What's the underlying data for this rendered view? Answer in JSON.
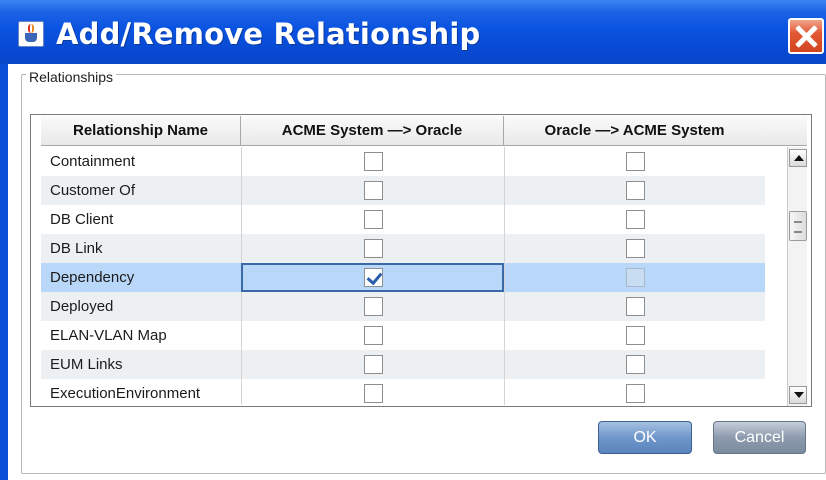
{
  "window": {
    "title": "Add/Remove Relationship",
    "icon": "java-cup-icon",
    "close_icon": "close-icon"
  },
  "group": {
    "label": "Relationships"
  },
  "table": {
    "headers": [
      "Relationship Name",
      "ACME System —> Oracle",
      "Oracle —> ACME System"
    ],
    "rows": [
      {
        "name": "Containment",
        "acme_to_oracle": false,
        "oracle_to_acme": false,
        "selected": false
      },
      {
        "name": "Customer Of",
        "acme_to_oracle": false,
        "oracle_to_acme": false,
        "selected": false
      },
      {
        "name": "DB Client",
        "acme_to_oracle": false,
        "oracle_to_acme": false,
        "selected": false
      },
      {
        "name": "DB Link",
        "acme_to_oracle": false,
        "oracle_to_acme": false,
        "selected": false
      },
      {
        "name": "Dependency",
        "acme_to_oracle": true,
        "oracle_to_acme": false,
        "selected": true,
        "oracle_to_acme_disabled": true
      },
      {
        "name": "Deployed",
        "acme_to_oracle": false,
        "oracle_to_acme": false,
        "selected": false
      },
      {
        "name": "ELAN-VLAN Map",
        "acme_to_oracle": false,
        "oracle_to_acme": false,
        "selected": false
      },
      {
        "name": "EUM Links",
        "acme_to_oracle": false,
        "oracle_to_acme": false,
        "selected": false
      },
      {
        "name": "ExecutionEnvironment",
        "acme_to_oracle": false,
        "oracle_to_acme": false,
        "selected": false
      }
    ]
  },
  "buttons": {
    "ok": "OK",
    "cancel": "Cancel"
  },
  "colors": {
    "titlebar": "#0a53e0",
    "selected_row": "#b8d7f9",
    "alt_row": "#edf0f3"
  }
}
